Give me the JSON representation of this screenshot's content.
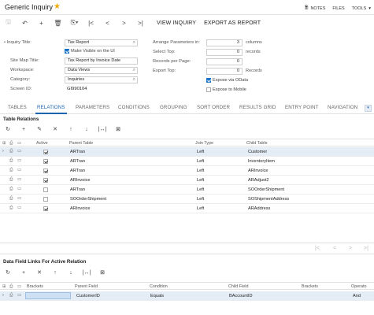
{
  "header": {
    "title": "Generic Inquiry",
    "notes": "NOTES",
    "files": "FILES",
    "tools": "TOOLS"
  },
  "toolbar": {
    "view_inquiry": "VIEW INQUIRY",
    "export_as_report": "EXPORT AS REPORT"
  },
  "form": {
    "inquiry_title_label": "Inquiry Title:",
    "inquiry_title_value": "Tax Report",
    "make_visible_label": "Make Visible on the UI",
    "make_visible_checked": true,
    "site_map_title_label": "Site Map Title:",
    "site_map_title_value": "Tax Report by Invoice Date",
    "workspace_label": "Workspace:",
    "workspace_value": "Data Views",
    "category_label": "Category:",
    "category_value": "Inquiries",
    "screen_id_label": "Screen ID:",
    "screen_id_value": "GI990104",
    "arrange_label": "Arrange Parameters in:",
    "arrange_value": "3",
    "arrange_unit": "columns",
    "select_top_label": "Select Top:",
    "select_top_value": "0",
    "select_top_unit": "records",
    "records_per_page_label": "Records per Page:",
    "records_per_page_value": "0",
    "export_top_label": "Export Top:",
    "export_top_value": "0",
    "export_top_unit": "Records",
    "expose_odata_label": "Expose via OData",
    "expose_odata_checked": true,
    "expose_mobile_label": "Expose to Mobile",
    "expose_mobile_checked": false
  },
  "tabs": [
    "TABLES",
    "RELATIONS",
    "PARAMETERS",
    "CONDITIONS",
    "GROUPING",
    "SORT ORDER",
    "RESULTS GRID",
    "ENTRY POINT",
    "NAVIGATION"
  ],
  "active_tab": "RELATIONS",
  "relations": {
    "title": "Table Relations",
    "headers": {
      "active": "Active",
      "parent": "Parent Table",
      "join": "Join Type",
      "child": "Child Table"
    },
    "rows": [
      {
        "active": true,
        "parent": "ARTran",
        "join": "Left",
        "child": "Customer"
      },
      {
        "active": true,
        "parent": "ARTran",
        "join": "Left",
        "child": "InventoryItem"
      },
      {
        "active": true,
        "parent": "ARTran",
        "join": "Left",
        "child": "ARInvoice"
      },
      {
        "active": true,
        "parent": "ARInvoice",
        "join": "Left",
        "child": "ARAdjust2"
      },
      {
        "active": false,
        "parent": "ARTran",
        "join": "Left",
        "child": "SOOrderShipment"
      },
      {
        "active": false,
        "parent": "SOOrderShipment",
        "join": "Left",
        "child": "SOShipmentAddress"
      },
      {
        "active": true,
        "parent": "ARInvoice",
        "join": "Left",
        "child": "ARAddress"
      }
    ]
  },
  "links": {
    "title": "Data Field Links For Active Relation",
    "headers": {
      "brackets": "Brackets",
      "parent_field": "Parent Field",
      "condition": "Condition",
      "child_field": "Child Field",
      "brackets2": "Brackets",
      "operator": "Operato"
    },
    "rows": [
      {
        "parent_field": "CustomerID",
        "condition": "Equals",
        "child_field": "BAccountID",
        "operator": "And"
      }
    ]
  },
  "colors": {
    "accent": "#1a64b0",
    "selected_row": "#e4edf6",
    "star": "#f2a900"
  }
}
